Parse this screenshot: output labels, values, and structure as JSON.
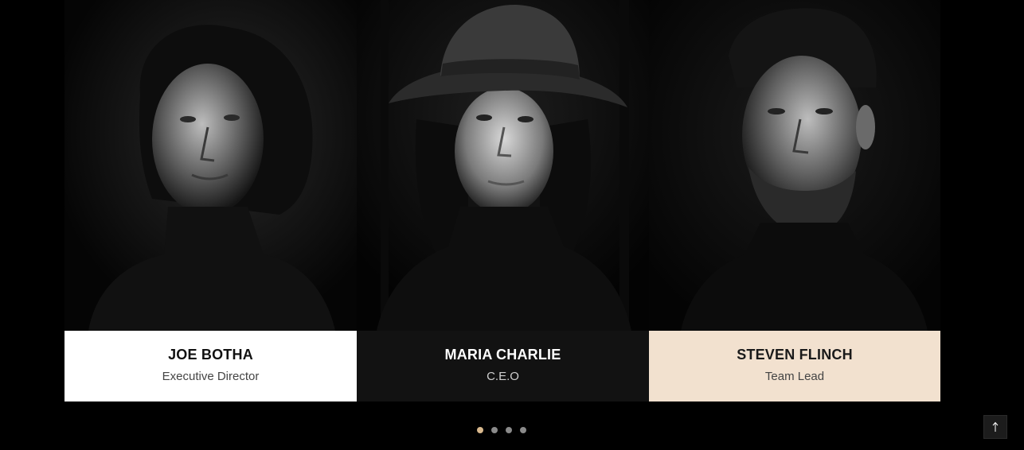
{
  "team": {
    "members": [
      {
        "name": "JOE BOTHA",
        "role": "Executive Director",
        "card_color": "#ffffff"
      },
      {
        "name": "MARIA CHARLIE",
        "role": "C.E.O",
        "card_color": "#121212"
      },
      {
        "name": "STEVEN FLINCH",
        "role": "Team Lead",
        "card_color": "#f2e1cf"
      }
    ]
  },
  "carousel": {
    "dot_count": 4,
    "active_index": 0,
    "active_color": "#d9b98e",
    "inactive_color": "#8a8a8a"
  },
  "scroll_top": {
    "icon": "arrow-up-icon"
  }
}
